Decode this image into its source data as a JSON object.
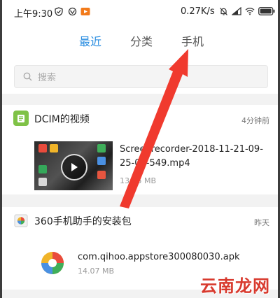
{
  "status": {
    "time": "上午9:30",
    "speed": "0.27K/s"
  },
  "tabs": [
    {
      "label": "最近",
      "active": true
    },
    {
      "label": "分类",
      "active": false
    },
    {
      "label": "手机",
      "active": false
    }
  ],
  "search": {
    "placeholder": "搜索"
  },
  "sections": [
    {
      "title": "DCIM的视频",
      "time": "4分钟前",
      "item": {
        "name_line1": "Screenrecorder-2018-11-21-09-",
        "name_line2": "25-04-549.mp4",
        "size": "13.35 MB"
      }
    },
    {
      "title": "360手机助手的安装包",
      "time": "昨天",
      "item": {
        "name": "com.qihoo.appstore300080030.apk",
        "size": "14.07 MB"
      }
    }
  ],
  "watermark": "云南龙网",
  "colors": {
    "accent": "#2a8de0",
    "folder": "#7fc246",
    "arrow": "#f03a2e"
  }
}
